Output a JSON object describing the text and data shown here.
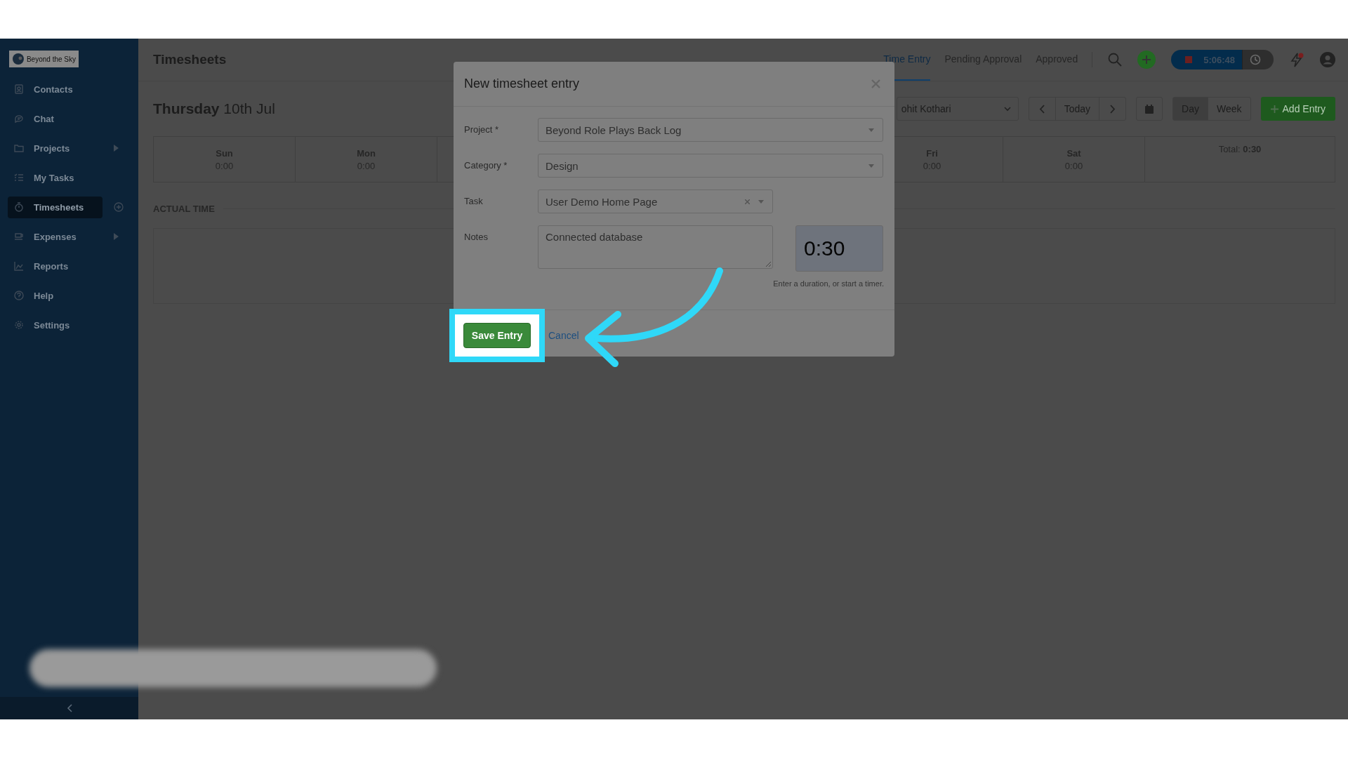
{
  "sidebar": {
    "logo_text": "Beyond the Sky",
    "items": [
      {
        "label": "Contacts",
        "kind": "contacts",
        "selected": false,
        "submenu": false,
        "add": false
      },
      {
        "label": "Chat",
        "kind": "chat",
        "selected": false,
        "submenu": false,
        "add": false
      },
      {
        "label": "Projects",
        "kind": "folder",
        "selected": false,
        "submenu": true,
        "add": false
      },
      {
        "label": "My Tasks",
        "kind": "tasks",
        "selected": false,
        "submenu": false,
        "add": false
      },
      {
        "label": "Timesheets",
        "kind": "stopwatch",
        "selected": true,
        "submenu": false,
        "add": true
      },
      {
        "label": "Expenses",
        "kind": "cup",
        "selected": false,
        "submenu": true,
        "add": false
      },
      {
        "label": "Reports",
        "kind": "chart",
        "selected": false,
        "submenu": false,
        "add": false
      },
      {
        "label": "Help",
        "kind": "help",
        "selected": false,
        "submenu": false,
        "add": false
      },
      {
        "label": "Settings",
        "kind": "gear",
        "selected": false,
        "submenu": false,
        "add": false
      }
    ]
  },
  "header": {
    "title": "Timesheets",
    "tabs": [
      {
        "label": "Time Entry",
        "selected": true
      },
      {
        "label": "Pending Approval",
        "selected": false
      },
      {
        "label": "Approved",
        "selected": false
      }
    ],
    "timer": "5:06:48",
    "notification_dot": true
  },
  "toolbar": {
    "date": "**Thursday** 10th Jul",
    "user_select": "ohit Kothari",
    "today": "Today",
    "views": [
      {
        "label": "Day",
        "selected": true
      },
      {
        "label": "Week",
        "selected": false
      }
    ],
    "add_button": "Add Entry"
  },
  "week": {
    "left_days": [
      {
        "day": "Sun",
        "hours": "0:00"
      },
      {
        "day": "Mon",
        "hours": "0:00"
      }
    ],
    "right_days": [
      {
        "day": "Fri",
        "hours": "0:00"
      },
      {
        "day": "Sat",
        "hours": "0:00"
      }
    ],
    "total": "Total: **0:30**"
  },
  "section": {
    "title": "ACTUAL TIME"
  },
  "dialog": {
    "title": "New timesheet entry",
    "fields": [
      {
        "label": "Project *",
        "value": "Beyond Role Plays Back Log",
        "kind": "select"
      },
      {
        "label": "Category *",
        "value": "Design",
        "kind": "select"
      },
      {
        "label": "Task",
        "value": "User Demo Home Page",
        "kind": "clearable"
      },
      {
        "label": "Notes",
        "value": "Connected database",
        "kind": "textarea"
      }
    ],
    "duration": "0:30",
    "hint": "Enter a duration, or start a timer.",
    "save": "Save Entry",
    "cancel": "Cancel"
  }
}
